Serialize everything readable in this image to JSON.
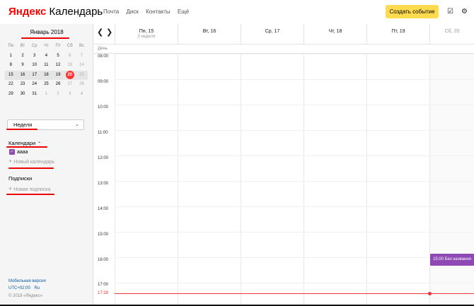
{
  "header": {
    "logo_brand": "Яндекс",
    "logo_product": "Календарь",
    "nav": [
      "Почта",
      "Диск",
      "Контакты",
      "Ещё"
    ],
    "create_button": "Создать событие",
    "tasks_icon": "checkbox-icon",
    "settings_icon": "gear-icon"
  },
  "sidebar": {
    "month_title": "Январь 2018",
    "weekdays": [
      "Пн",
      "Вт",
      "Ср",
      "Чт",
      "Пт",
      "Сб",
      "Вс"
    ],
    "weeks": [
      [
        "1",
        "2",
        "3",
        "4",
        "5",
        "6",
        "7"
      ],
      [
        "8",
        "9",
        "10",
        "11",
        "12",
        "13",
        "14"
      ],
      [
        "15",
        "16",
        "17",
        "18",
        "19",
        "20",
        "21"
      ],
      [
        "22",
        "23",
        "24",
        "25",
        "26",
        "27",
        "28"
      ],
      [
        "29",
        "30",
        "31",
        "1",
        "2",
        "3",
        "4"
      ]
    ],
    "today": "20",
    "view_select": "Неделя",
    "calendars_title": "Календари",
    "calendar_item": "аааа",
    "new_calendar": "Новый календарь",
    "subscriptions_title": "Подписки",
    "new_subscription": "Новая подписка",
    "mobile_link": "Мобильная версия",
    "timezone": "UTC+02:00",
    "lang": "Ru",
    "copyright": "© 2018 «Яндекс»"
  },
  "week": {
    "allday_label": "День",
    "days": [
      {
        "name": "Пн, 15",
        "week": "3 неделя"
      },
      {
        "name": "Вт, 16",
        "week": ""
      },
      {
        "name": "Ср, 17",
        "week": ""
      },
      {
        "name": "Чт, 18",
        "week": ""
      },
      {
        "name": "Пт, 19",
        "week": ""
      },
      {
        "name": "Сб, 20",
        "week": ""
      }
    ],
    "times": [
      "08:00",
      "09:00",
      "10:00",
      "11:00",
      "12:00",
      "13:00",
      "14:00",
      "15:00",
      "16:00",
      "17:00"
    ],
    "now_time": "17:28",
    "event": {
      "time": "15:00",
      "title": "Без названия"
    }
  },
  "colors": {
    "accent_yellow": "#ffdb4d",
    "calendar_purple": "#8e49b5",
    "now_red": "#e33",
    "annotation_red": "#e00"
  }
}
